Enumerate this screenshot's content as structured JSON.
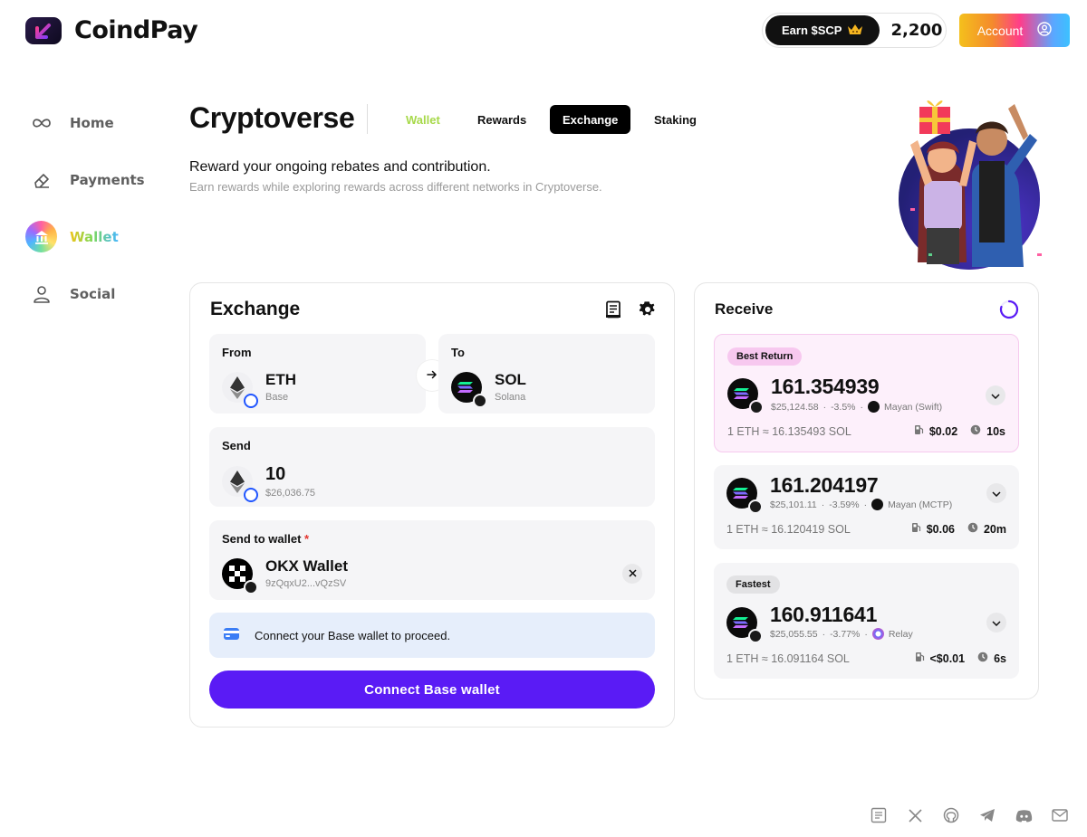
{
  "app": {
    "name": "CoindPay"
  },
  "header": {
    "earn_label": "Earn $SCP",
    "earn_count": "2,200",
    "account_label": "Account"
  },
  "sidebar": {
    "items": [
      {
        "label": "Home",
        "icon": "infinity-icon"
      },
      {
        "label": "Payments",
        "icon": "eraser-icon"
      },
      {
        "label": "Wallet",
        "icon": "bank-icon",
        "active": true
      },
      {
        "label": "Social",
        "icon": "user-icon"
      }
    ]
  },
  "page": {
    "title": "Cryptoverse",
    "tabs": [
      "Wallet",
      "Rewards",
      "Exchange",
      "Staking"
    ],
    "active_tab": "Exchange",
    "subtitle": "Reward your ongoing rebates and contribution.",
    "subtext": "Earn rewards while exploring rewards across different networks in Cryptoverse."
  },
  "exchange": {
    "title": "Exchange",
    "from": {
      "label": "From",
      "token": "ETH",
      "chain": "Base"
    },
    "to": {
      "label": "To",
      "token": "SOL",
      "chain": "Solana"
    },
    "send": {
      "label": "Send",
      "amount": "10",
      "usd": "$26,036.75"
    },
    "wallet": {
      "label": "Send to wallet",
      "required_mark": "*",
      "name": "OKX Wallet",
      "address": "9zQqxU2...vQzSV"
    },
    "notice": "Connect your Base wallet to proceed.",
    "cta": "Connect Base wallet"
  },
  "receive": {
    "title": "Receive",
    "quotes": [
      {
        "badge": "Best Return",
        "amount": "161.354939",
        "usd": "$25,124.58",
        "pct": "-3.5%",
        "provider": "Mayan (Swift)",
        "rate": "1 ETH ≈ 16.135493 SOL",
        "fee": "$0.02",
        "time": "10s"
      },
      {
        "badge": "",
        "amount": "161.204197",
        "usd": "$25,101.11",
        "pct": "-3.59%",
        "provider": "Mayan (MCTP)",
        "rate": "1 ETH ≈ 16.120419 SOL",
        "fee": "$0.06",
        "time": "20m"
      },
      {
        "badge": "Fastest",
        "amount": "160.911641",
        "usd": "$25,055.55",
        "pct": "-3.77%",
        "provider": "Relay",
        "rate": "1 ETH ≈ 16.091164 SOL",
        "fee": "<$0.01",
        "time": "6s"
      }
    ]
  },
  "footer": {
    "icons": [
      "docs-icon",
      "x-icon",
      "github-icon",
      "telegram-icon",
      "discord-icon",
      "mail-icon"
    ]
  },
  "colors": {
    "primary": "#5a1bf5",
    "best_bg": "#fdf0fb",
    "notice_bg": "#e6eefb"
  }
}
